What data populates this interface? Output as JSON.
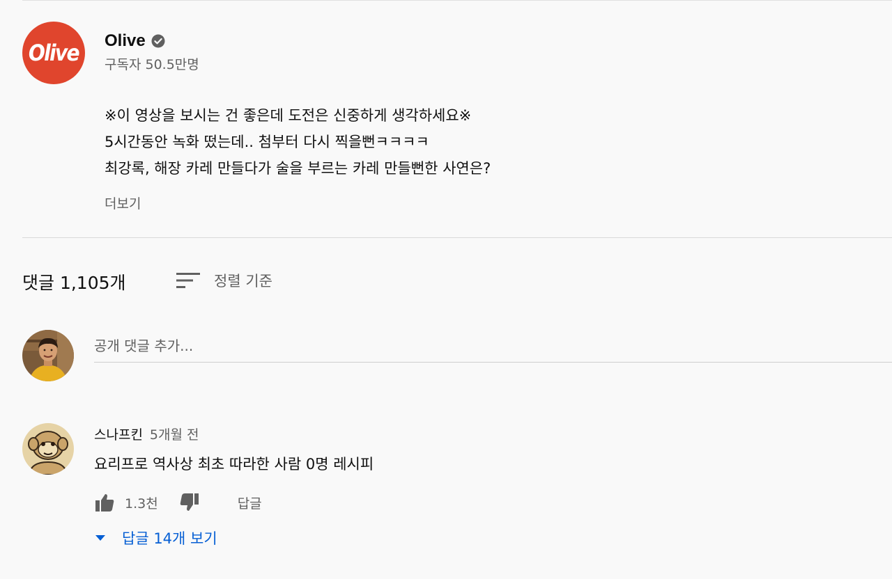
{
  "channel": {
    "logo_text": "Olive",
    "name": "Olive",
    "verified_icon": "verified-check-icon",
    "subscribers": "구독자 50.5만명"
  },
  "description": {
    "lines": [
      "※이 영상을 보시는 건 좋은데 도전은 신중하게 생각하세요※",
      "5시간동안 녹화 떴는데.. 첨부터 다시 찍을뻔ㅋㅋㅋㅋ",
      "최강록, 해장 카레 만들다가 술을 부르는 카레 만들뻔한 사연은?"
    ],
    "show_more": "더보기"
  },
  "comments": {
    "count_label": "댓글 1,105개",
    "sort_icon": "sort-icon",
    "sort_label": "정렬 기준",
    "add_placeholder": "공개 댓글 추가..."
  },
  "thread": {
    "author": "스나프킨",
    "time": "5개월 전",
    "text": "요리프로 역사상 최초 따라한 사람 0명 레시피",
    "like_icon": "thumbs-up-icon",
    "likes": "1.3천",
    "dislike_icon": "thumbs-down-icon",
    "reply_label": "답글",
    "view_replies_icon": "caret-down-icon",
    "view_replies": "답글 14개 보기"
  },
  "colors": {
    "brand": "#e0452d",
    "link": "#065fd4",
    "secondary_text": "#606060",
    "background": "#f9f9f9"
  }
}
